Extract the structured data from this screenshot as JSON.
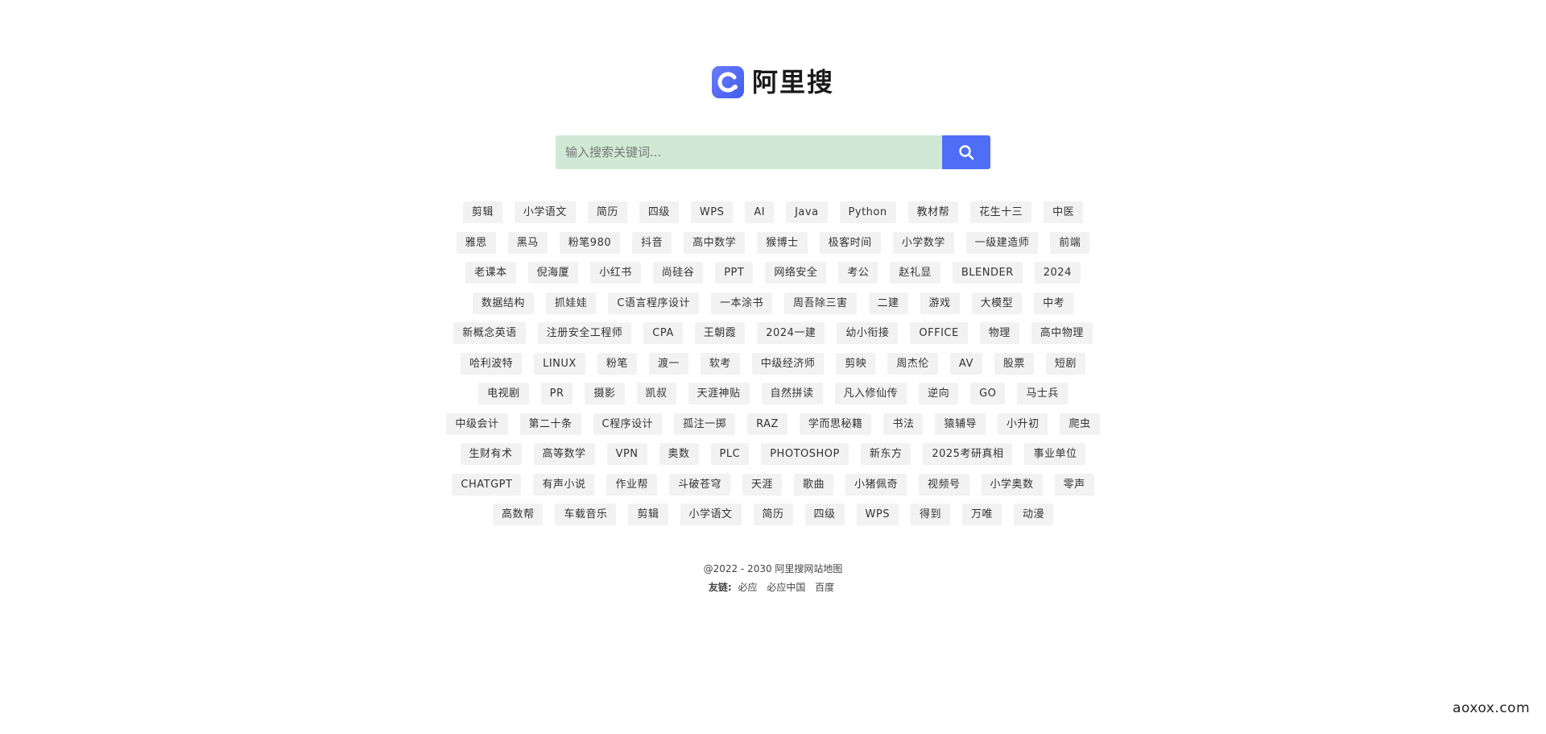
{
  "logo": {
    "text": "阿里搜",
    "icon": "logo-c-icon",
    "brand_color": "#4f6ef7"
  },
  "search": {
    "placeholder": "输入搜索关键词...",
    "value": "",
    "icon": "search-icon",
    "input_bg": "#cfe9d4"
  },
  "tag_rows": [
    [
      "剪辑",
      "小学语文",
      "简历",
      "四级",
      "WPS",
      "AI",
      "Java",
      "Python",
      "教材帮",
      "花生十三",
      "中医"
    ],
    [
      "雅思",
      "黑马",
      "粉笔980",
      "抖音",
      "高中数学",
      "猴博士",
      "极客时间",
      "小学数学",
      "一级建造师",
      "前端"
    ],
    [
      "老课本",
      "倪海厦",
      "小红书",
      "尚硅谷",
      "PPT",
      "网络安全",
      "考公",
      "赵礼显",
      "BLENDER",
      "2024"
    ],
    [
      "数据结构",
      "抓娃娃",
      "C语言程序设计",
      "一本涂书",
      "周吾除三害",
      "二建",
      "游戏",
      "大模型",
      "中考"
    ],
    [
      "新概念英语",
      "注册安全工程师",
      "CPA",
      "王朝霞",
      "2024一建",
      "幼小衔接",
      "OFFICE",
      "物理",
      "高中物理"
    ],
    [
      "哈利波特",
      "LINUX",
      "粉笔",
      "渡一",
      "软考",
      "中级经济师",
      "剪映",
      "周杰伦",
      "AV",
      "股票",
      "短剧"
    ],
    [
      "电视剧",
      "PR",
      "摄影",
      "凯叔",
      "天涯神贴",
      "自然拼读",
      "凡入修仙传",
      "逆向",
      "GO",
      "马士兵"
    ],
    [
      "中级会计",
      "第二十条",
      "C程序设计",
      "孤注一掷",
      "RAZ",
      "学而思秘籍",
      "书法",
      "猿辅导",
      "小升初",
      "爬虫"
    ],
    [
      "生财有术",
      "高等数学",
      "VPN",
      "奥数",
      "PLC",
      "PHOTOSHOP",
      "新东方",
      "2025考研真相",
      "事业单位"
    ],
    [
      "CHATGPT",
      "有声小说",
      "作业帮",
      "斗破苍穹",
      "天涯",
      "歌曲",
      "小猪佩奇",
      "视频号",
      "小学奥数",
      "零声"
    ],
    [
      "高数帮",
      "车载音乐",
      "剪辑",
      "小学语文",
      "简历",
      "四级",
      "WPS",
      "得到",
      "万唯",
      "动漫"
    ]
  ],
  "footer": {
    "copyright": "@2022 - 2030 阿里搜网站地图",
    "links_label": "友链:",
    "links": [
      "必应",
      "必应中国",
      "百度"
    ]
  },
  "watermark": "aoxox.com"
}
